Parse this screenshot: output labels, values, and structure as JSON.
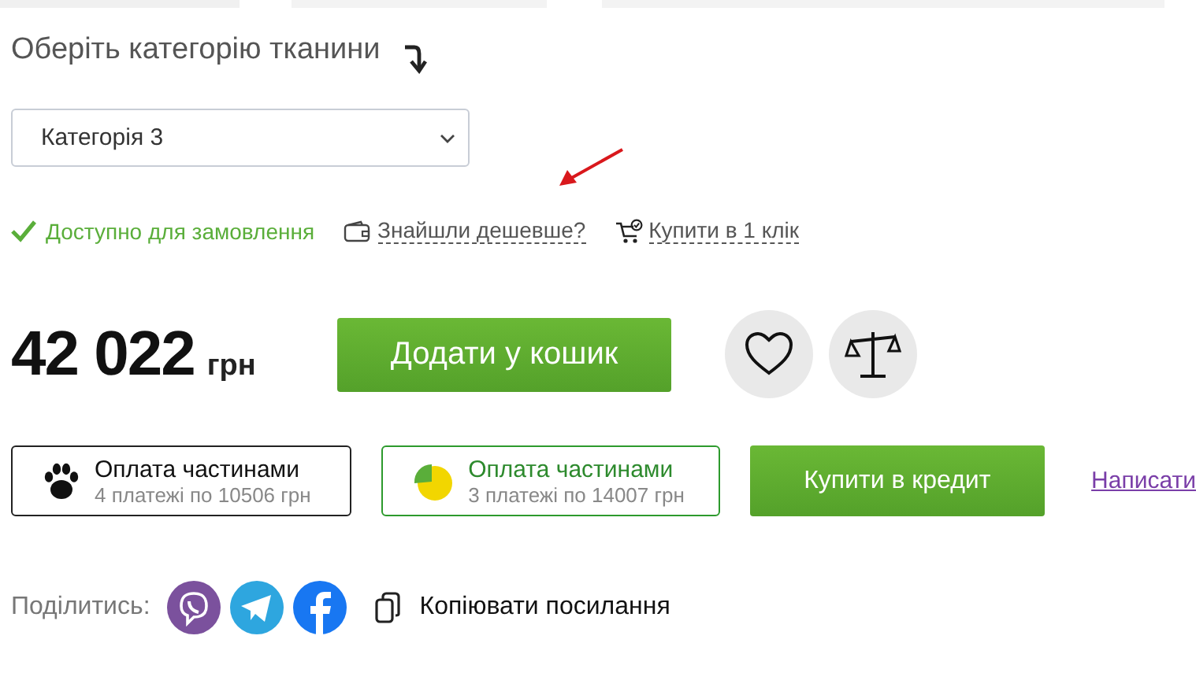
{
  "category": {
    "title": "Оберіть категорію тканини",
    "selected_value": "Категорія 3"
  },
  "availability": {
    "status": "Доступно для замовлення",
    "in_stock": true
  },
  "links": [
    {
      "kind": "cheaper",
      "label": "Знайшли дешевше?"
    },
    {
      "kind": "oneclick",
      "label": "Купити в 1 клік"
    }
  ],
  "price": {
    "amount": "42 022",
    "currency": "грн"
  },
  "add_to_cart": "Додати у кошик",
  "installments": [
    {
      "kind": "paw",
      "title": "Оплата частинами",
      "detail": "4 платежі по 10506 грн"
    },
    {
      "kind": "pie",
      "title": "Оплата частинами",
      "detail": "3 платежі по 14007 грн"
    }
  ],
  "credit_button": "Купити в кредит",
  "write_link": "Написати",
  "share": {
    "label": "Поділитись:",
    "networks": [
      {
        "kind": "viber"
      },
      {
        "kind": "telegram"
      },
      {
        "kind": "facebook"
      }
    ],
    "copy_link": "Копіювати посилання"
  }
}
